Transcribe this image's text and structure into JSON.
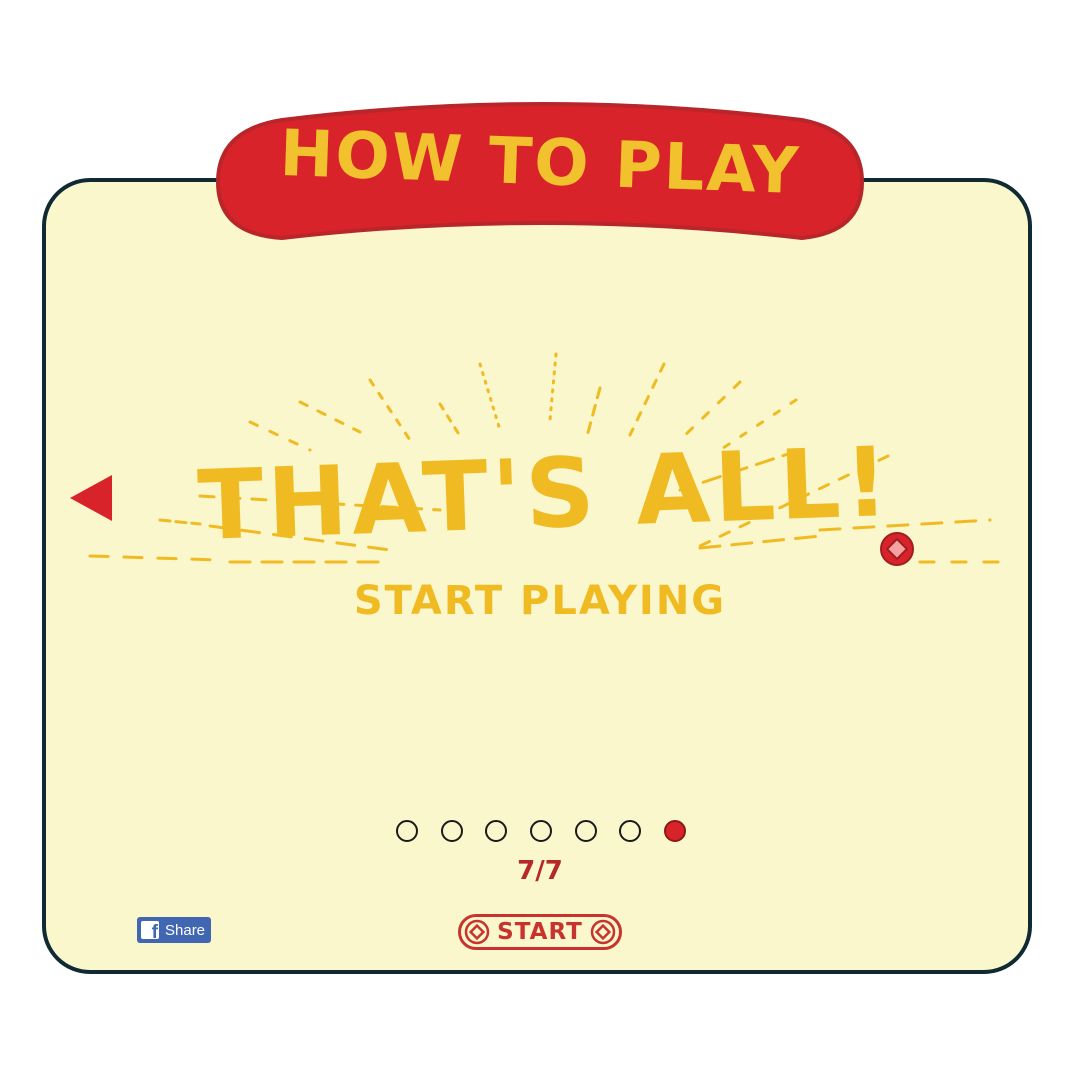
{
  "header": {
    "title": "HOW TO PLAY"
  },
  "slide": {
    "headline": "THAT'S ALL!",
    "subtitle": "START PLAYING"
  },
  "pagination": {
    "total": 7,
    "current": 7,
    "counter_text": "7/7"
  },
  "footer": {
    "share_label": "Share",
    "start_label": "START"
  },
  "icons": {
    "prev": "triangle-left-icon",
    "share": "facebook-icon",
    "coin": "red-coin-icon",
    "start_gems": "diamond-icon"
  },
  "colors": {
    "panel_background": "#faf7cc",
    "panel_border": "#0f2a33",
    "banner_red": "#d9232b",
    "title_yellow": "#f2c12e",
    "accent_red": "#c8332e",
    "facebook_blue": "#4267b2"
  }
}
